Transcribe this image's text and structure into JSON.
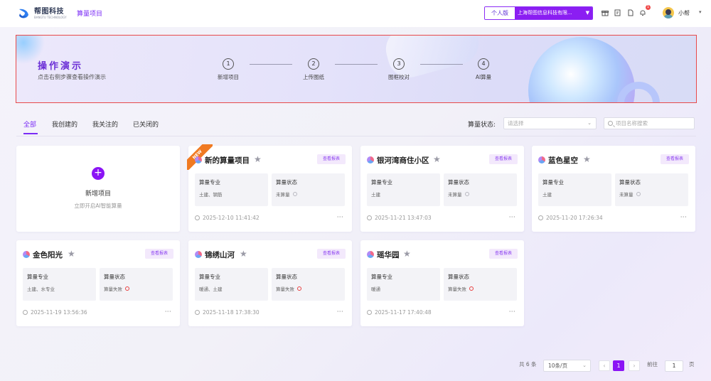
{
  "header": {
    "logo_title": "帮图科技",
    "logo_subtitle": "BANGTU TECHNOLOGY",
    "nav_item": "算量项目",
    "edition_label": "个人版",
    "company_name": "上海帮图信息科技有限...",
    "notification_count": "1",
    "username": "小帮"
  },
  "banner": {
    "title": "操作演示",
    "subtitle": "点击右侧步骤查看操作演示",
    "steps": [
      {
        "num": "1",
        "label": "新增项目"
      },
      {
        "num": "2",
        "label": "上传图纸"
      },
      {
        "num": "3",
        "label": "图框校对"
      },
      {
        "num": "4",
        "label": "AI算量"
      }
    ]
  },
  "tabs": [
    "全部",
    "我创建的",
    "我关注的",
    "已关闭的"
  ],
  "filter": {
    "status_label": "算量状态:",
    "status_placeholder": "请选择",
    "search_placeholder": "项目名称搜索"
  },
  "new_project": {
    "title": "新增项目",
    "subtitle": "立即开启AI智能算量",
    "plus": "+"
  },
  "labels": {
    "discipline": "算量专业",
    "status": "算量状态",
    "report": "查看报表",
    "new_ribbon": "NEW",
    "more": "···"
  },
  "projects": [
    {
      "name": "新的算量项目",
      "discipline": "土建、钢筋",
      "status": "未算量",
      "status_color": "#b8b8c0",
      "time": "2025-12-10 11:41:42",
      "is_new": true
    },
    {
      "name": "银河湾商住小区",
      "discipline": "土建",
      "status": "未算量",
      "status_color": "#b8b8c0",
      "time": "2025-11-21 13:47:03"
    },
    {
      "name": "蓝色星空",
      "discipline": "土建",
      "status": "未算量",
      "status_color": "#b8b8c0",
      "time": "2025-11-20 17:26:34"
    },
    {
      "name": "金色阳光",
      "discipline": "土建、水专业",
      "status": "算量失败",
      "status_color": "#e84040",
      "time": "2025-11-19 13:56:36"
    },
    {
      "name": "锦绣山河",
      "discipline": "暖通、土建",
      "status": "算量失败",
      "status_color": "#e84040",
      "time": "2025-11-18 17:38:30"
    },
    {
      "name": "瑶华园",
      "discipline": "暖通",
      "status": "算量失败",
      "status_color": "#e84040",
      "time": "2025-11-17 17:40:48"
    }
  ],
  "pagination": {
    "total": "共 6 条",
    "page_size": "10条/页",
    "prev": "‹",
    "current": "1",
    "next": "›",
    "goto_label": "前往",
    "goto_value": "1",
    "page_suffix": "页"
  },
  "colors": {
    "accent": "#8b14f5",
    "banner_border": "#e84a4a",
    "ribbon": "#f07a22"
  }
}
